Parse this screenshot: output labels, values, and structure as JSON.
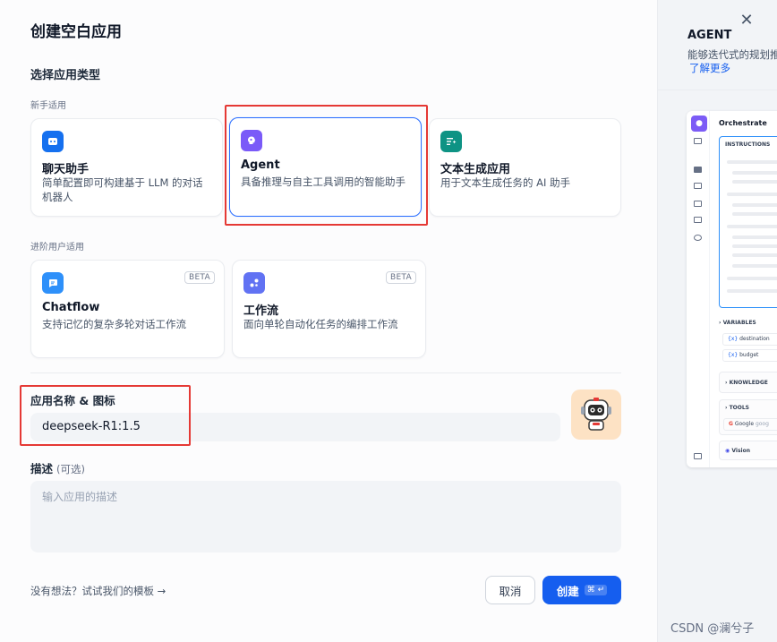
{
  "dialog": {
    "title": "创建空白应用",
    "type_section_title": "选择应用类型",
    "beginner_label": "新手适用",
    "advanced_label": "进阶用户适用"
  },
  "app_types": {
    "chat": {
      "title": "聊天助手",
      "desc": "简单配置即可构建基于 LLM 的对话机器人"
    },
    "agent": {
      "title": "Agent",
      "desc": "具备推理与自主工具调用的智能助手"
    },
    "completion": {
      "title": "文本生成应用",
      "desc": "用于文本生成任务的 AI 助手"
    },
    "chatflow": {
      "title": "Chatflow",
      "desc": "支持记忆的复杂多轮对话工作流",
      "badge": "BETA"
    },
    "workflow": {
      "title": "工作流",
      "desc": "面向单轮自动化任务的编排工作流",
      "badge": "BETA"
    }
  },
  "form": {
    "name_label": "应用名称 & 图标",
    "name_value": "deepseek-R1:1.5",
    "desc_label": "描述",
    "desc_optional": "(可选)",
    "desc_placeholder": "输入应用的描述"
  },
  "footer": {
    "template_link": "没有想法？试试我们的模板 →",
    "cancel_label": "取消",
    "create_label": "创建",
    "create_shortcut": "⌘ ↵"
  },
  "preview_panel": {
    "title": "AGENT",
    "desc": "能够迭代式的规划推",
    "learn_more": "了解更多",
    "mock": {
      "orchestrate": "Orchestrate",
      "instructions": "INSTRUCTIONS",
      "variables": "VARIABLES",
      "var_1": "destination",
      "var_2": "budget",
      "knowledge": "KNOWLEDGE",
      "tools": "TOOLS",
      "tool_1": "Google",
      "tool_1_suffix": "goog",
      "vision": "Vision"
    }
  },
  "watermark": "CSDN @澜兮子",
  "colors": {
    "primary": "#155eef",
    "selected_border": "#296dff",
    "annotation_red": "#e53935",
    "chat_icon": "#1570ef",
    "agent_icon": "#7a5af8",
    "completion_icon": "#0e9384",
    "chatflow_icon": "#2e90fa",
    "workflow_icon": "#6172f3"
  }
}
